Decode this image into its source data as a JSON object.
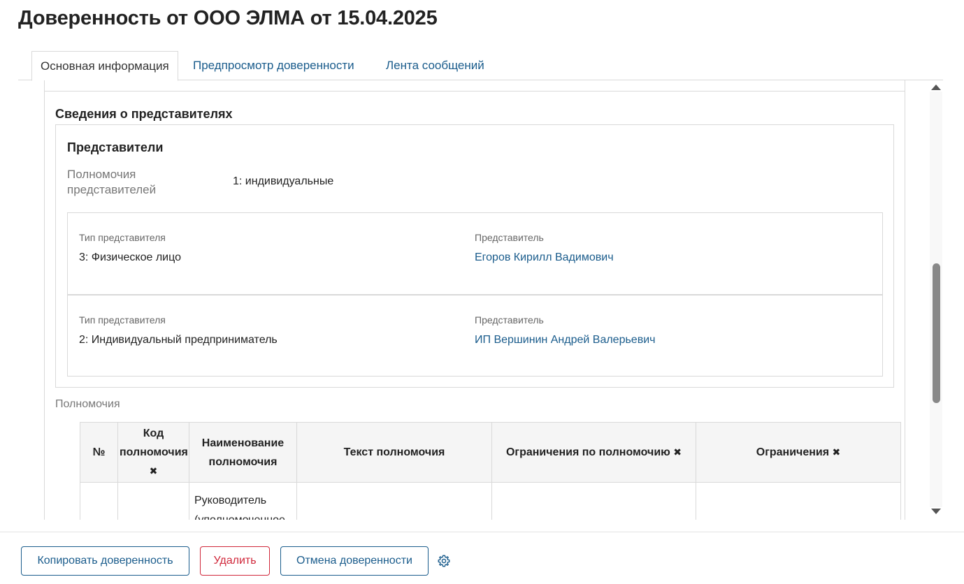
{
  "page": {
    "title": "Доверенность от ООО ЭЛМА от 15.04.2025"
  },
  "tabs": [
    {
      "label": "Основная информация",
      "active": true
    },
    {
      "label": "Предпросмотр доверенности",
      "active": false
    },
    {
      "label": "Лента сообщений",
      "active": false
    }
  ],
  "section": {
    "title": "Сведения о представителях"
  },
  "representatives": {
    "title": "Представители",
    "powers_label": "Полномочия представителей",
    "powers_value": "1: индивидуальные",
    "rows": [
      {
        "type_label": "Тип представителя",
        "type_value": "3: Физическое лицо",
        "rep_label": "Представитель",
        "rep_value": "Егоров Кирилл Вадимович"
      },
      {
        "type_label": "Тип представителя",
        "type_value": "2: Индивидуальный предприниматель",
        "rep_label": "Представитель",
        "rep_value": "ИП Вершинин Андрей Валерьевич"
      }
    ]
  },
  "powers": {
    "label": "Полномочия",
    "columns": [
      "№",
      "Код полномочия",
      "Наименование полномочия",
      "Текст полномочия",
      "Ограничения по полномочию",
      "Ограничения"
    ],
    "rows": [
      [
        "",
        "",
        "Руководитель (уполномоченное",
        "",
        "",
        ""
      ]
    ]
  },
  "footer": {
    "copy_label": "Копировать доверенность",
    "delete_label": "Удалить",
    "cancel_label": "Отмена доверенности"
  },
  "colors": {
    "link": "#1a5c8c",
    "danger": "#d0273a",
    "border": "#d9d9d9"
  },
  "icons": {
    "pin": "pin-icon",
    "gear": "gear-icon"
  }
}
